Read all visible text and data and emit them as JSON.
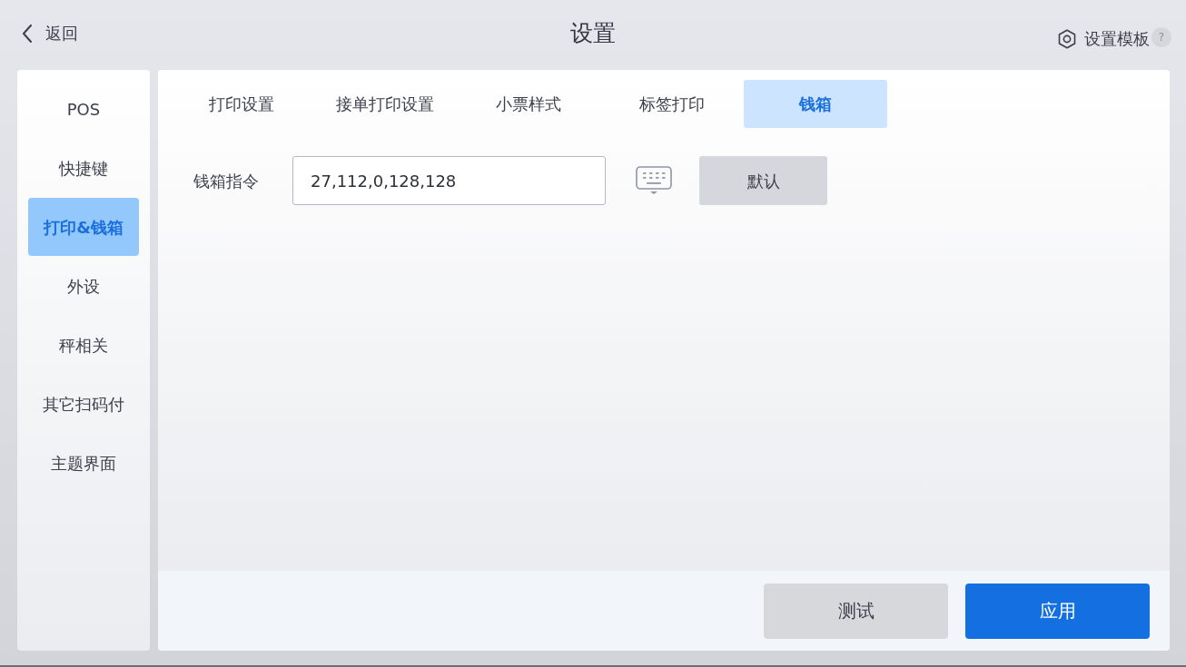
{
  "header": {
    "back": {
      "label": "返回"
    },
    "title": "设置",
    "template": {
      "label": "设置模板",
      "help": "?"
    }
  },
  "sidebar": {
    "items": [
      {
        "label": "POS",
        "selected": false
      },
      {
        "label": "快捷键",
        "selected": false
      },
      {
        "label": "打印&钱箱",
        "selected": true
      },
      {
        "label": "外设",
        "selected": false
      },
      {
        "label": "秤相关",
        "selected": false
      },
      {
        "label": "其它扫码付",
        "selected": false
      },
      {
        "label": "主题界面",
        "selected": false
      }
    ]
  },
  "tabs": [
    {
      "label": "打印设置",
      "selected": false
    },
    {
      "label": "接单打印设置",
      "selected": false
    },
    {
      "label": "小票样式",
      "selected": false
    },
    {
      "label": "标签打印",
      "selected": false
    },
    {
      "label": "钱箱",
      "selected": true
    }
  ],
  "form": {
    "fields": [
      {
        "label": "钱箱指令",
        "value": "27,112,0,128,128",
        "button": "默认"
      }
    ]
  },
  "footer": {
    "buttons": [
      {
        "label": "测试",
        "kind": "secondary"
      },
      {
        "label": "应用",
        "kind": "primary"
      }
    ]
  }
}
